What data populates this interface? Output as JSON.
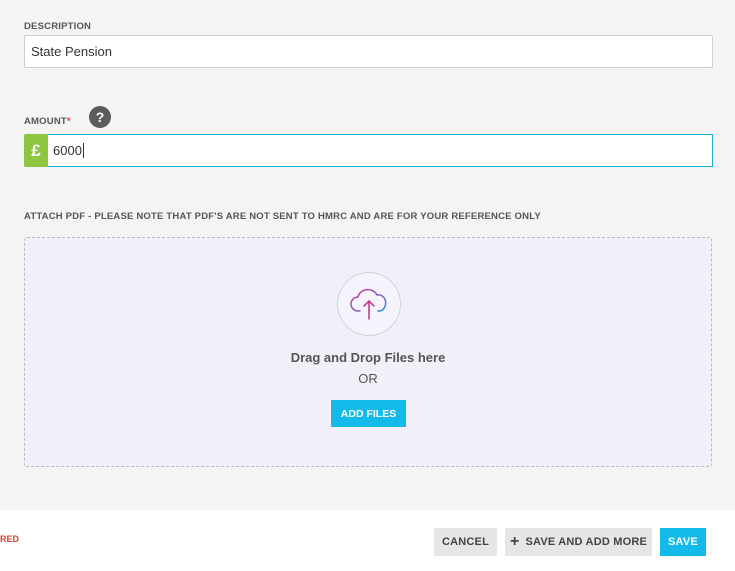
{
  "description": {
    "label": "DESCRIPTION",
    "value": "State Pension"
  },
  "amount": {
    "label": "AMOUNT",
    "required_marker": "*",
    "help_icon": "?",
    "currency_symbol": "£",
    "value": "6000"
  },
  "attach": {
    "label": "ATTACH PDF - PLEASE NOTE THAT PDF'S ARE NOT SENT TO HMRC AND ARE FOR YOUR REFERENCE ONLY",
    "upload_icon": "cloud-upload-icon",
    "drag_text": "Drag and Drop Files here",
    "or_text": "OR",
    "add_files_label": "ADD FILES"
  },
  "footer": {
    "required_note": "RED",
    "cancel_label": "CANCEL",
    "save_more_label": "SAVE AND ADD MORE",
    "save_more_icon": "+",
    "save_label": "SAVE"
  },
  "colors": {
    "accent": "#14bbea",
    "currency_bg": "#8ec641",
    "required": "#e0403c"
  }
}
